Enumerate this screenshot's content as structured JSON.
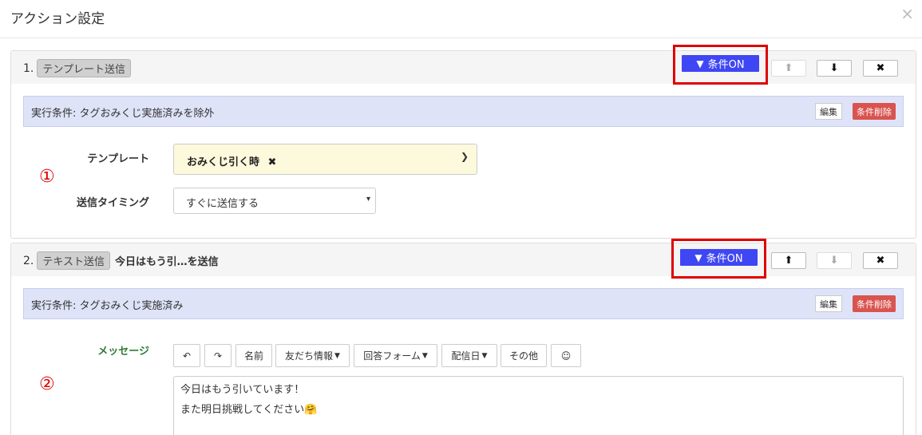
{
  "modal": {
    "title": "アクション設定",
    "close_glyph": "×"
  },
  "condition_button_label": "条件ON",
  "condition_prefix": "実行条件:",
  "edit_label": "編集",
  "delete_condition_label": "条件削除",
  "actions": [
    {
      "number": "1.",
      "type": "テンプレート送信",
      "title": "",
      "condition": "タグおみくじ実施済みを除外",
      "marker": "①",
      "move_up_enabled": false,
      "move_down_enabled": true,
      "fields": {
        "template_label": "テンプレート",
        "template_value": "おみくじ引く時",
        "timing_label": "送信タイミング",
        "timing_value": "すぐに送信する"
      }
    },
    {
      "number": "2.",
      "type": "テキスト送信",
      "title": "今日はもう引…を送信",
      "condition": "タグおみくじ実施済み",
      "marker": "②",
      "move_up_enabled": true,
      "move_down_enabled": false,
      "fields": {
        "message_label": "メッセージ",
        "toolbar": [
          "名前",
          "友だち情報",
          "回答フォーム",
          "配信日",
          "その他"
        ],
        "message_lines": [
          "今日はもう引いています！",
          "また明日挑戦してください🤗"
        ]
      }
    }
  ],
  "colors": {
    "condition_on": "#3f46f4",
    "highlight_border": "#e00000",
    "delete_red": "#d9534f",
    "condition_bar": "#dfe3f8",
    "template_bg": "#fdf9dc",
    "message_label": "#2e7d32"
  },
  "icons": [
    "funnel-icon",
    "arrow-up-icon",
    "arrow-down-icon",
    "close-icon",
    "undo-icon",
    "redo-icon",
    "caret-down-icon",
    "emoji-icon"
  ]
}
